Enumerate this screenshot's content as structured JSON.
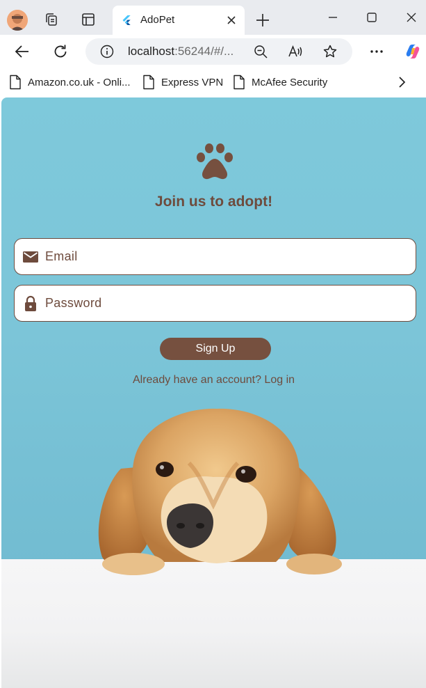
{
  "browser": {
    "tab": {
      "title": "AdoPet"
    },
    "address_bar": {
      "host": "localhost",
      "rest": ":56244/#/..."
    },
    "bookmarks": [
      {
        "label": "Amazon.co.uk - Onli..."
      },
      {
        "label": "Express VPN"
      },
      {
        "label": "McAfee Security"
      }
    ],
    "accent_color": "#0c59a4"
  },
  "page": {
    "headline": "Join us to adopt!",
    "email_field": {
      "placeholder": "Email",
      "value": ""
    },
    "password_field": {
      "placeholder": "Password",
      "value": ""
    },
    "signup_button": "Sign Up",
    "login_link": "Already have an account? Log in",
    "colors": {
      "brand_brown": "#6e4b3d",
      "button_brown": "#76503f",
      "background_blue": "#7ec9db"
    },
    "icons": [
      "paw-icon",
      "mail-icon",
      "lock-icon"
    ]
  }
}
